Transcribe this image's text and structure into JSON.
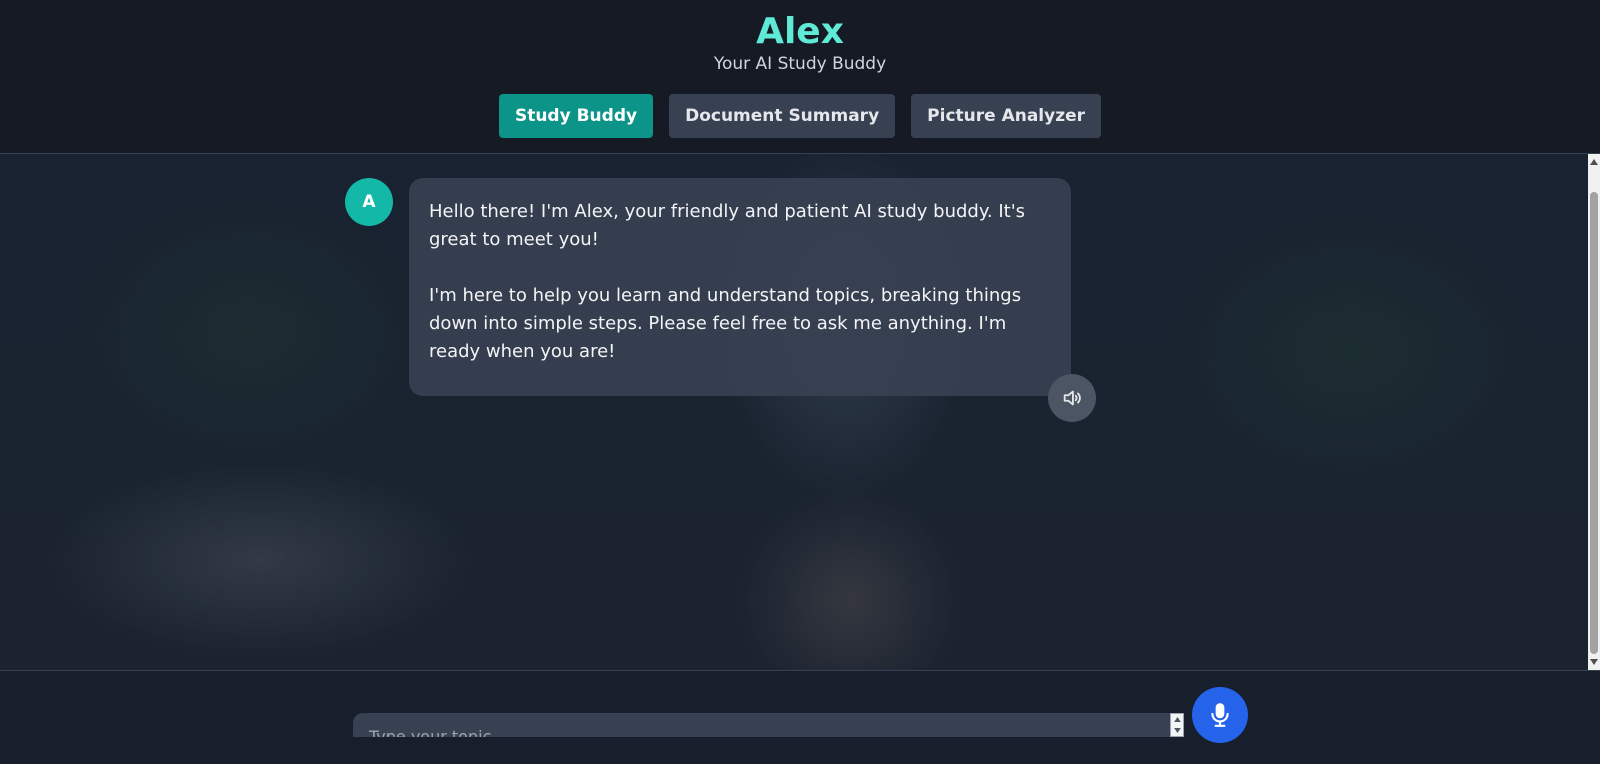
{
  "app": {
    "title": "Alex",
    "subtitle": "Your AI Study Buddy"
  },
  "tabs": [
    {
      "label": "Study Buddy",
      "active": true
    },
    {
      "label": "Document Summary",
      "active": false
    },
    {
      "label": "Picture Analyzer",
      "active": false
    }
  ],
  "chat": {
    "messages": [
      {
        "sender": "assistant",
        "avatar_letter": "A",
        "paragraphs": [
          "Hello there! I'm Alex, your friendly and patient AI study buddy. It's great to meet you!",
          "I'm here to help you learn and understand topics, breaking things down into simple steps. Please feel free to ask me anything. I'm ready when you are!"
        ],
        "speak_icon": "speaker-icon"
      }
    ]
  },
  "composer": {
    "placeholder": "Type your topic...",
    "mic_icon": "microphone-icon"
  },
  "colors": {
    "accent_title": "#5eead4",
    "tab_active": "#0d9488",
    "tab_inactive": "#374151",
    "avatar": "#14b8a6",
    "bubble": "#374151",
    "mic_button": "#2563eb"
  }
}
